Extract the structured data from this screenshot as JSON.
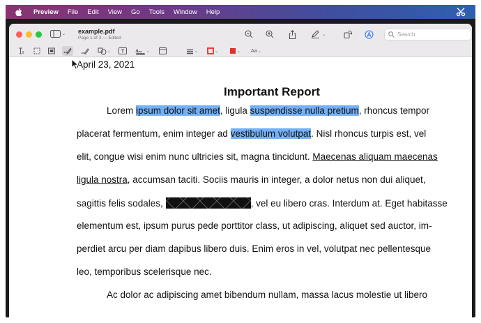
{
  "menubar": {
    "app_name": "Preview",
    "items": [
      "File",
      "Edit",
      "View",
      "Go",
      "Tools",
      "Window",
      "Help"
    ]
  },
  "window": {
    "doc_name": "example.pdf",
    "doc_subtitle": "Page 1 of 3 — Edited",
    "search_placeholder": "Search"
  },
  "document": {
    "date": "April 23, 2021",
    "title": "Important Report",
    "lines": [
      {
        "segments": [
          {
            "t": "Lorem "
          },
          {
            "t": "ipsum dolor sit amet",
            "s": "hl"
          },
          {
            "t": ", ligula "
          },
          {
            "t": "suspendisse nulla pretium",
            "s": "hl"
          },
          {
            "t": ", rhoncus tempor"
          }
        ]
      },
      {
        "segments": [
          {
            "t": "placerat fermentum, enim integer ad "
          },
          {
            "t": "vestibulum volutpat",
            "s": "hl"
          },
          {
            "t": ". Nisl rhoncus turpis est, vel"
          }
        ]
      },
      {
        "segments": [
          {
            "t": "elit, congue wisi enim nunc ultricies sit, magna tincidunt. "
          },
          {
            "t": "Maecenas aliquam maecenas",
            "s": "ul"
          }
        ]
      },
      {
        "segments": [
          {
            "t": "ligula nostra",
            "s": "ul"
          },
          {
            "t": ", accumsan taciti. Sociis mauris in integer, a dolor netus non dui aliquet,"
          }
        ]
      },
      {
        "segments": [
          {
            "t": "sagittis felis sodales, "
          },
          {
            "t": "",
            "s": "redact"
          },
          {
            "t": ", vel eu libero cras. Interdum at. Eget habitasse"
          }
        ]
      },
      {
        "segments": [
          {
            "t": "elementum est, ipsum purus pede porttitor class, ut adipiscing, aliquet sed auctor, im-"
          }
        ]
      },
      {
        "segments": [
          {
            "t": "perdiet arcu per diam dapibus libero duis. Enim eros in vel, volutpat nec pellentesque"
          }
        ]
      },
      {
        "segments": [
          {
            "t": "leo, temporibus scelerisque nec."
          }
        ]
      },
      {
        "segments": [
          {
            "t": "Ac dolor ac adipiscing amet bibendum nullam, massa lacus molestie ut libero"
          }
        ]
      }
    ]
  },
  "colors": {
    "highlight": "#74b0f7",
    "shape_border_color": "#e0312a",
    "fill_color": "#e0312a"
  },
  "markup_text_style": "Aa"
}
